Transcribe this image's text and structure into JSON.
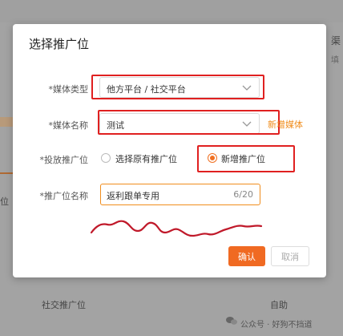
{
  "background": {
    "header_right_char_1": "渠",
    "header_right_char_2": "填",
    "left_fragment": "位",
    "footer_left": "社交推广位",
    "footer_right": "自助",
    "watermark": "公众号 · 好狗不挡道"
  },
  "dialog": {
    "title": "选择推广位",
    "media_type": {
      "label": "*媒体类型",
      "value": "他方平台 / 社交平台"
    },
    "media_name": {
      "label": "*媒体名称",
      "value": "测试",
      "add_link": "新增媒体"
    },
    "placement": {
      "label": "*投放推广位",
      "options": [
        {
          "label": "选择原有推广位",
          "checked": false
        },
        {
          "label": "新增推广位",
          "checked": true
        }
      ]
    },
    "placement_name": {
      "label": "*推广位名称",
      "value": "返利跟单专用",
      "counter": "6/20"
    },
    "confirm_label": "确认",
    "cancel_label": "取消"
  },
  "colors": {
    "accent": "#f06a22",
    "annotation": "#e02020",
    "link": "#f08d1d"
  }
}
